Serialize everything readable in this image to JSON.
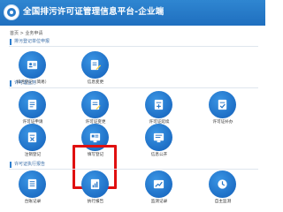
{
  "header": {
    "title": "全国排污许可证管理信息平台-企业端"
  },
  "breadcrumb": "首页 > 业务申请",
  "sections": [
    {
      "label": "排污登记单位申报",
      "tiles": [
        {
          "label": "排污登记（简易）",
          "icon": "id-card-icon"
        },
        {
          "label": "信息变更",
          "icon": "edit-document-icon"
        }
      ]
    },
    {
      "label": "许可证业务",
      "tiles": [
        {
          "label": "许可证申请",
          "icon": "document-icon"
        },
        {
          "label": "许可证变更",
          "icon": "document-edit-icon"
        },
        {
          "label": "许可证延续",
          "icon": "document-plus-icon"
        },
        {
          "label": "许可证补办",
          "icon": "document-check-icon"
        },
        {
          "label": "注销登记",
          "icon": "document-cancel-icon"
        },
        {
          "label": "填写登记",
          "icon": "monitor-form-icon"
        },
        {
          "label": "信息公开",
          "icon": "monitor-icon"
        }
      ]
    },
    {
      "label": "许可证执行报告",
      "tiles": [
        {
          "label": "台账记录",
          "icon": "ledger-icon"
        },
        {
          "label": "执行报告",
          "icon": "report-icon"
        },
        {
          "label": "监测记录",
          "icon": "chart-icon"
        },
        {
          "label": "自主监测",
          "icon": "monitoring-icon"
        }
      ]
    }
  ]
}
